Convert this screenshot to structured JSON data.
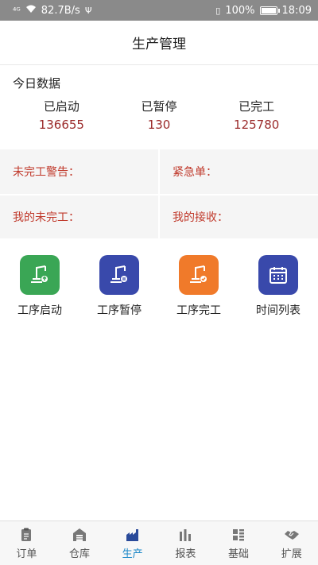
{
  "status_bar": {
    "signal": "⁴ᴳ",
    "speed": "82.7B/s",
    "usb": "Ψ",
    "vibrate": "▯",
    "battery": "100%",
    "time": "18:09"
  },
  "header": {
    "title": "生产管理"
  },
  "today": {
    "title": "今日数据",
    "stats": [
      {
        "label": "已启动",
        "value": "136655"
      },
      {
        "label": "已暂停",
        "value": "130"
      },
      {
        "label": "已完工",
        "value": "125780"
      }
    ]
  },
  "warnings": {
    "unfinished_alert": "未完工警告：",
    "urgent_order": "紧急单：",
    "my_unfinished": "我的未完工：",
    "my_received": "我的接收："
  },
  "actions": [
    {
      "label": "工序启动",
      "color": "#3aa655",
      "icon": "crane-start-icon"
    },
    {
      "label": "工序暂停",
      "color": "#3949ab",
      "icon": "crane-pause-icon"
    },
    {
      "label": "工序完工",
      "color": "#f07a2a",
      "icon": "crane-done-icon"
    },
    {
      "label": "时间列表",
      "color": "#3949ab",
      "icon": "calendar-icon"
    }
  ],
  "tabs": [
    {
      "label": "订单",
      "icon": "clipboard-icon"
    },
    {
      "label": "仓库",
      "icon": "warehouse-icon"
    },
    {
      "label": "生产",
      "icon": "factory-icon",
      "active": true
    },
    {
      "label": "报表",
      "icon": "bar-chart-icon"
    },
    {
      "label": "基础",
      "icon": "grid-list-icon"
    },
    {
      "label": "扩展",
      "icon": "handshake-icon"
    }
  ]
}
